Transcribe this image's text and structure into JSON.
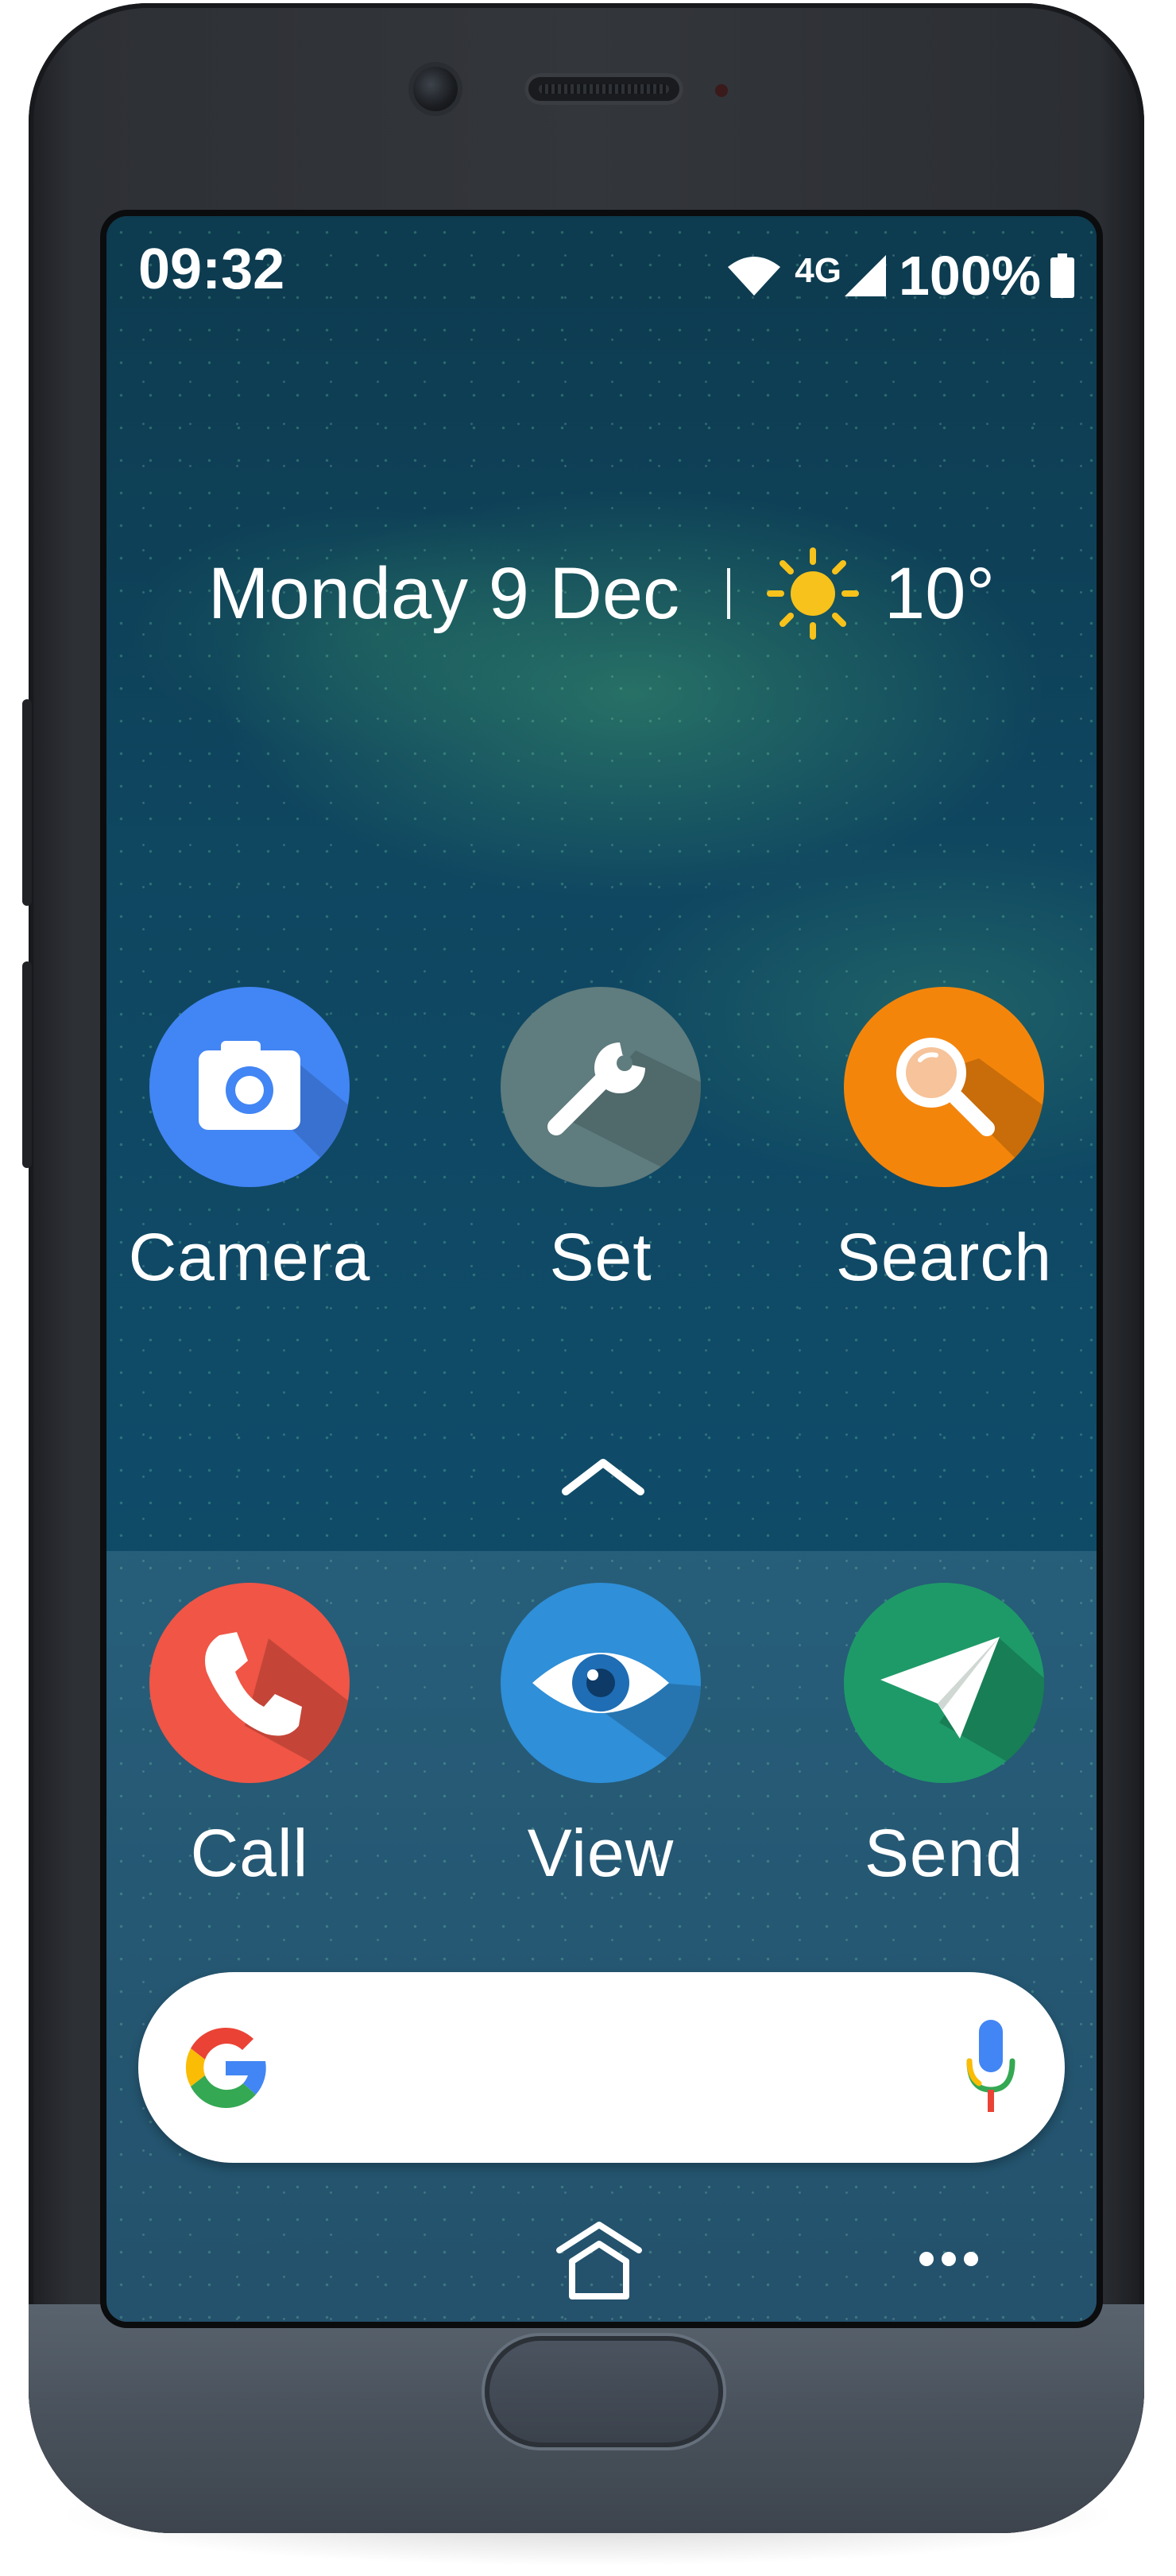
{
  "status_bar": {
    "time": "09:32",
    "network": "4G",
    "battery": "100%",
    "icons": [
      "wifi-icon",
      "signal-icon",
      "battery-icon"
    ]
  },
  "header": {
    "date": "Monday 9 Dec",
    "weather_icon": "sun-icon",
    "temperature": "10°"
  },
  "apps": [
    {
      "label": "Camera",
      "icon": "camera-icon",
      "color": "#4285f4"
    },
    {
      "label": "Set",
      "icon": "wrench-icon",
      "color": "#5f7c7e"
    },
    {
      "label": "Search",
      "icon": "magnifier-icon",
      "color": "#f4850b"
    }
  ],
  "dock_apps": [
    {
      "label": "Call",
      "icon": "phone-icon",
      "color": "#f05545"
    },
    {
      "label": "View",
      "icon": "eye-icon",
      "color": "#2f8fd8"
    },
    {
      "label": "Send",
      "icon": "paper-plane-icon",
      "color": "#1e9a68"
    }
  ],
  "search": {
    "logo": "google-g-icon",
    "mic": "mic-icon",
    "placeholder": ""
  },
  "nav": {
    "home": "home-icon",
    "more": "more-icon"
  },
  "theme": {
    "screen_background": "#0f4660",
    "text_color": "#ffffff",
    "device_body": "#33363b"
  }
}
